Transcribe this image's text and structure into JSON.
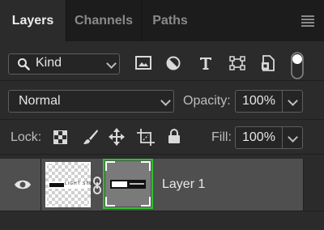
{
  "tabs": [
    {
      "label": "Layers",
      "active": true
    },
    {
      "label": "Channels",
      "active": false
    },
    {
      "label": "Paths",
      "active": false
    }
  ],
  "filter": {
    "kind_label": "Kind",
    "icons": [
      "image-filter-icon",
      "adjustment-filter-icon",
      "type-filter-icon",
      "shape-filter-icon",
      "smart-object-filter-icon",
      "filter-toggle-icon"
    ]
  },
  "blend": {
    "mode": "Normal",
    "opacity_label": "Opacity:",
    "opacity_value": "100%"
  },
  "lock": {
    "label": "Lock:",
    "icons": [
      "lock-transparent-pixels-icon",
      "lock-image-pixels-icon",
      "lock-position-icon",
      "lock-artboard-icon",
      "lock-all-icon"
    ],
    "fill_label": "Fill:",
    "fill_value": "100%"
  },
  "layers": [
    {
      "name": "Layer 1",
      "visible": true,
      "thumbnail_text": "LIGHT STUDIO",
      "mask_selected": true
    }
  ],
  "colors": {
    "panel_bg": "#2b2b2b",
    "selected_row": "#4f4f4f",
    "mask_highlight": "#2fc12f"
  }
}
